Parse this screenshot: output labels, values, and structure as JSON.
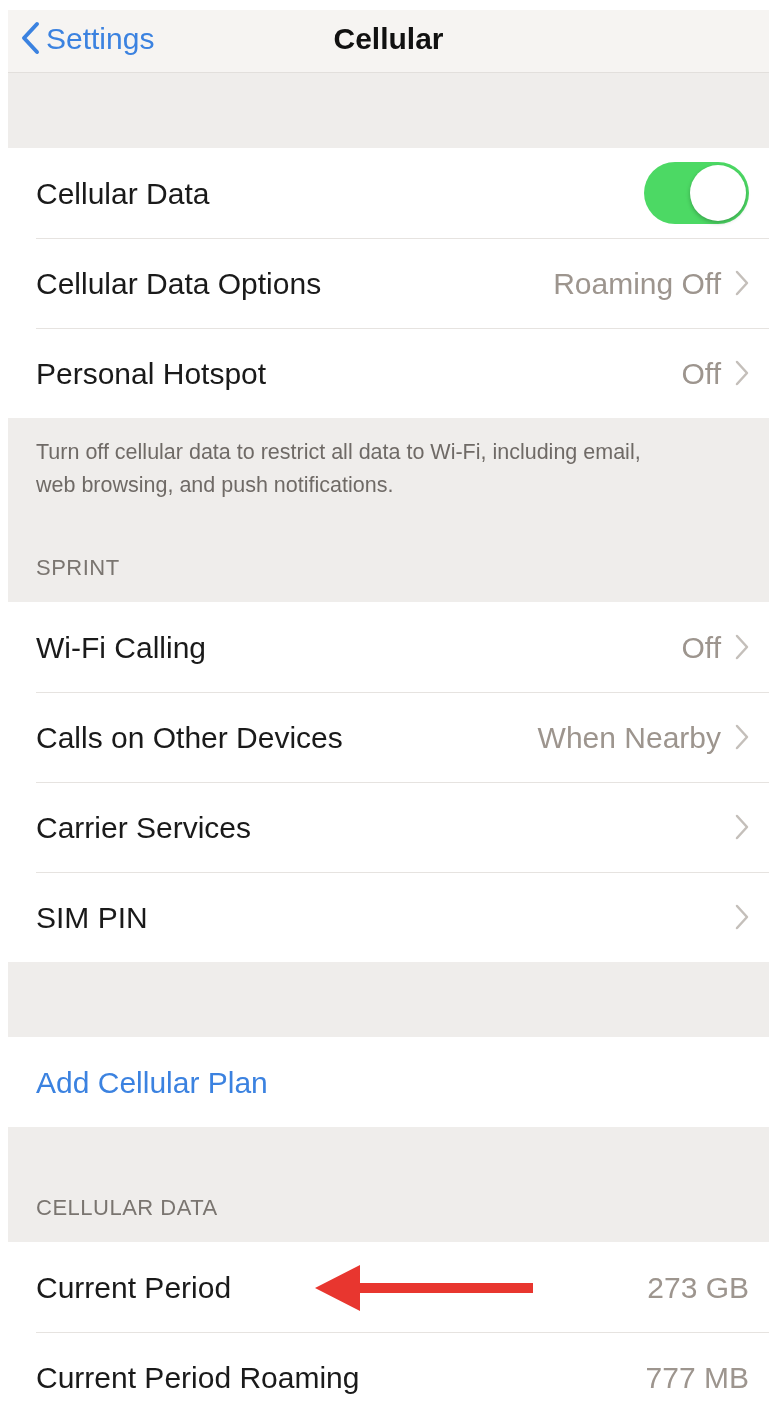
{
  "nav": {
    "back_label": "Settings",
    "title": "Cellular"
  },
  "sections": [
    {
      "rows": [
        {
          "kind": "toggle",
          "label": "Cellular Data",
          "on": true
        },
        {
          "kind": "disclosure",
          "label": "Cellular Data Options",
          "value": "Roaming Off"
        },
        {
          "kind": "disclosure",
          "label": "Personal Hotspot",
          "value": "Off"
        }
      ],
      "footer": "Turn off cellular data to restrict all data to Wi-Fi, including email, web browsing, and push notifications."
    },
    {
      "header": "SPRINT",
      "rows": [
        {
          "kind": "disclosure",
          "label": "Wi-Fi Calling",
          "value": "Off"
        },
        {
          "kind": "disclosure",
          "label": "Calls on Other Devices",
          "value": "When Nearby"
        },
        {
          "kind": "disclosure",
          "label": "Carrier Services"
        },
        {
          "kind": "disclosure",
          "label": "SIM PIN"
        }
      ]
    },
    {
      "rows": [
        {
          "kind": "link",
          "label": "Add Cellular Plan"
        }
      ]
    },
    {
      "header": "CELLULAR DATA",
      "rows": [
        {
          "kind": "stat",
          "label": "Current Period",
          "value": "273 GB",
          "annotated": true
        },
        {
          "kind": "stat",
          "label": "Current Period Roaming",
          "value": "777 MB",
          "annotated": false
        }
      ]
    }
  ]
}
